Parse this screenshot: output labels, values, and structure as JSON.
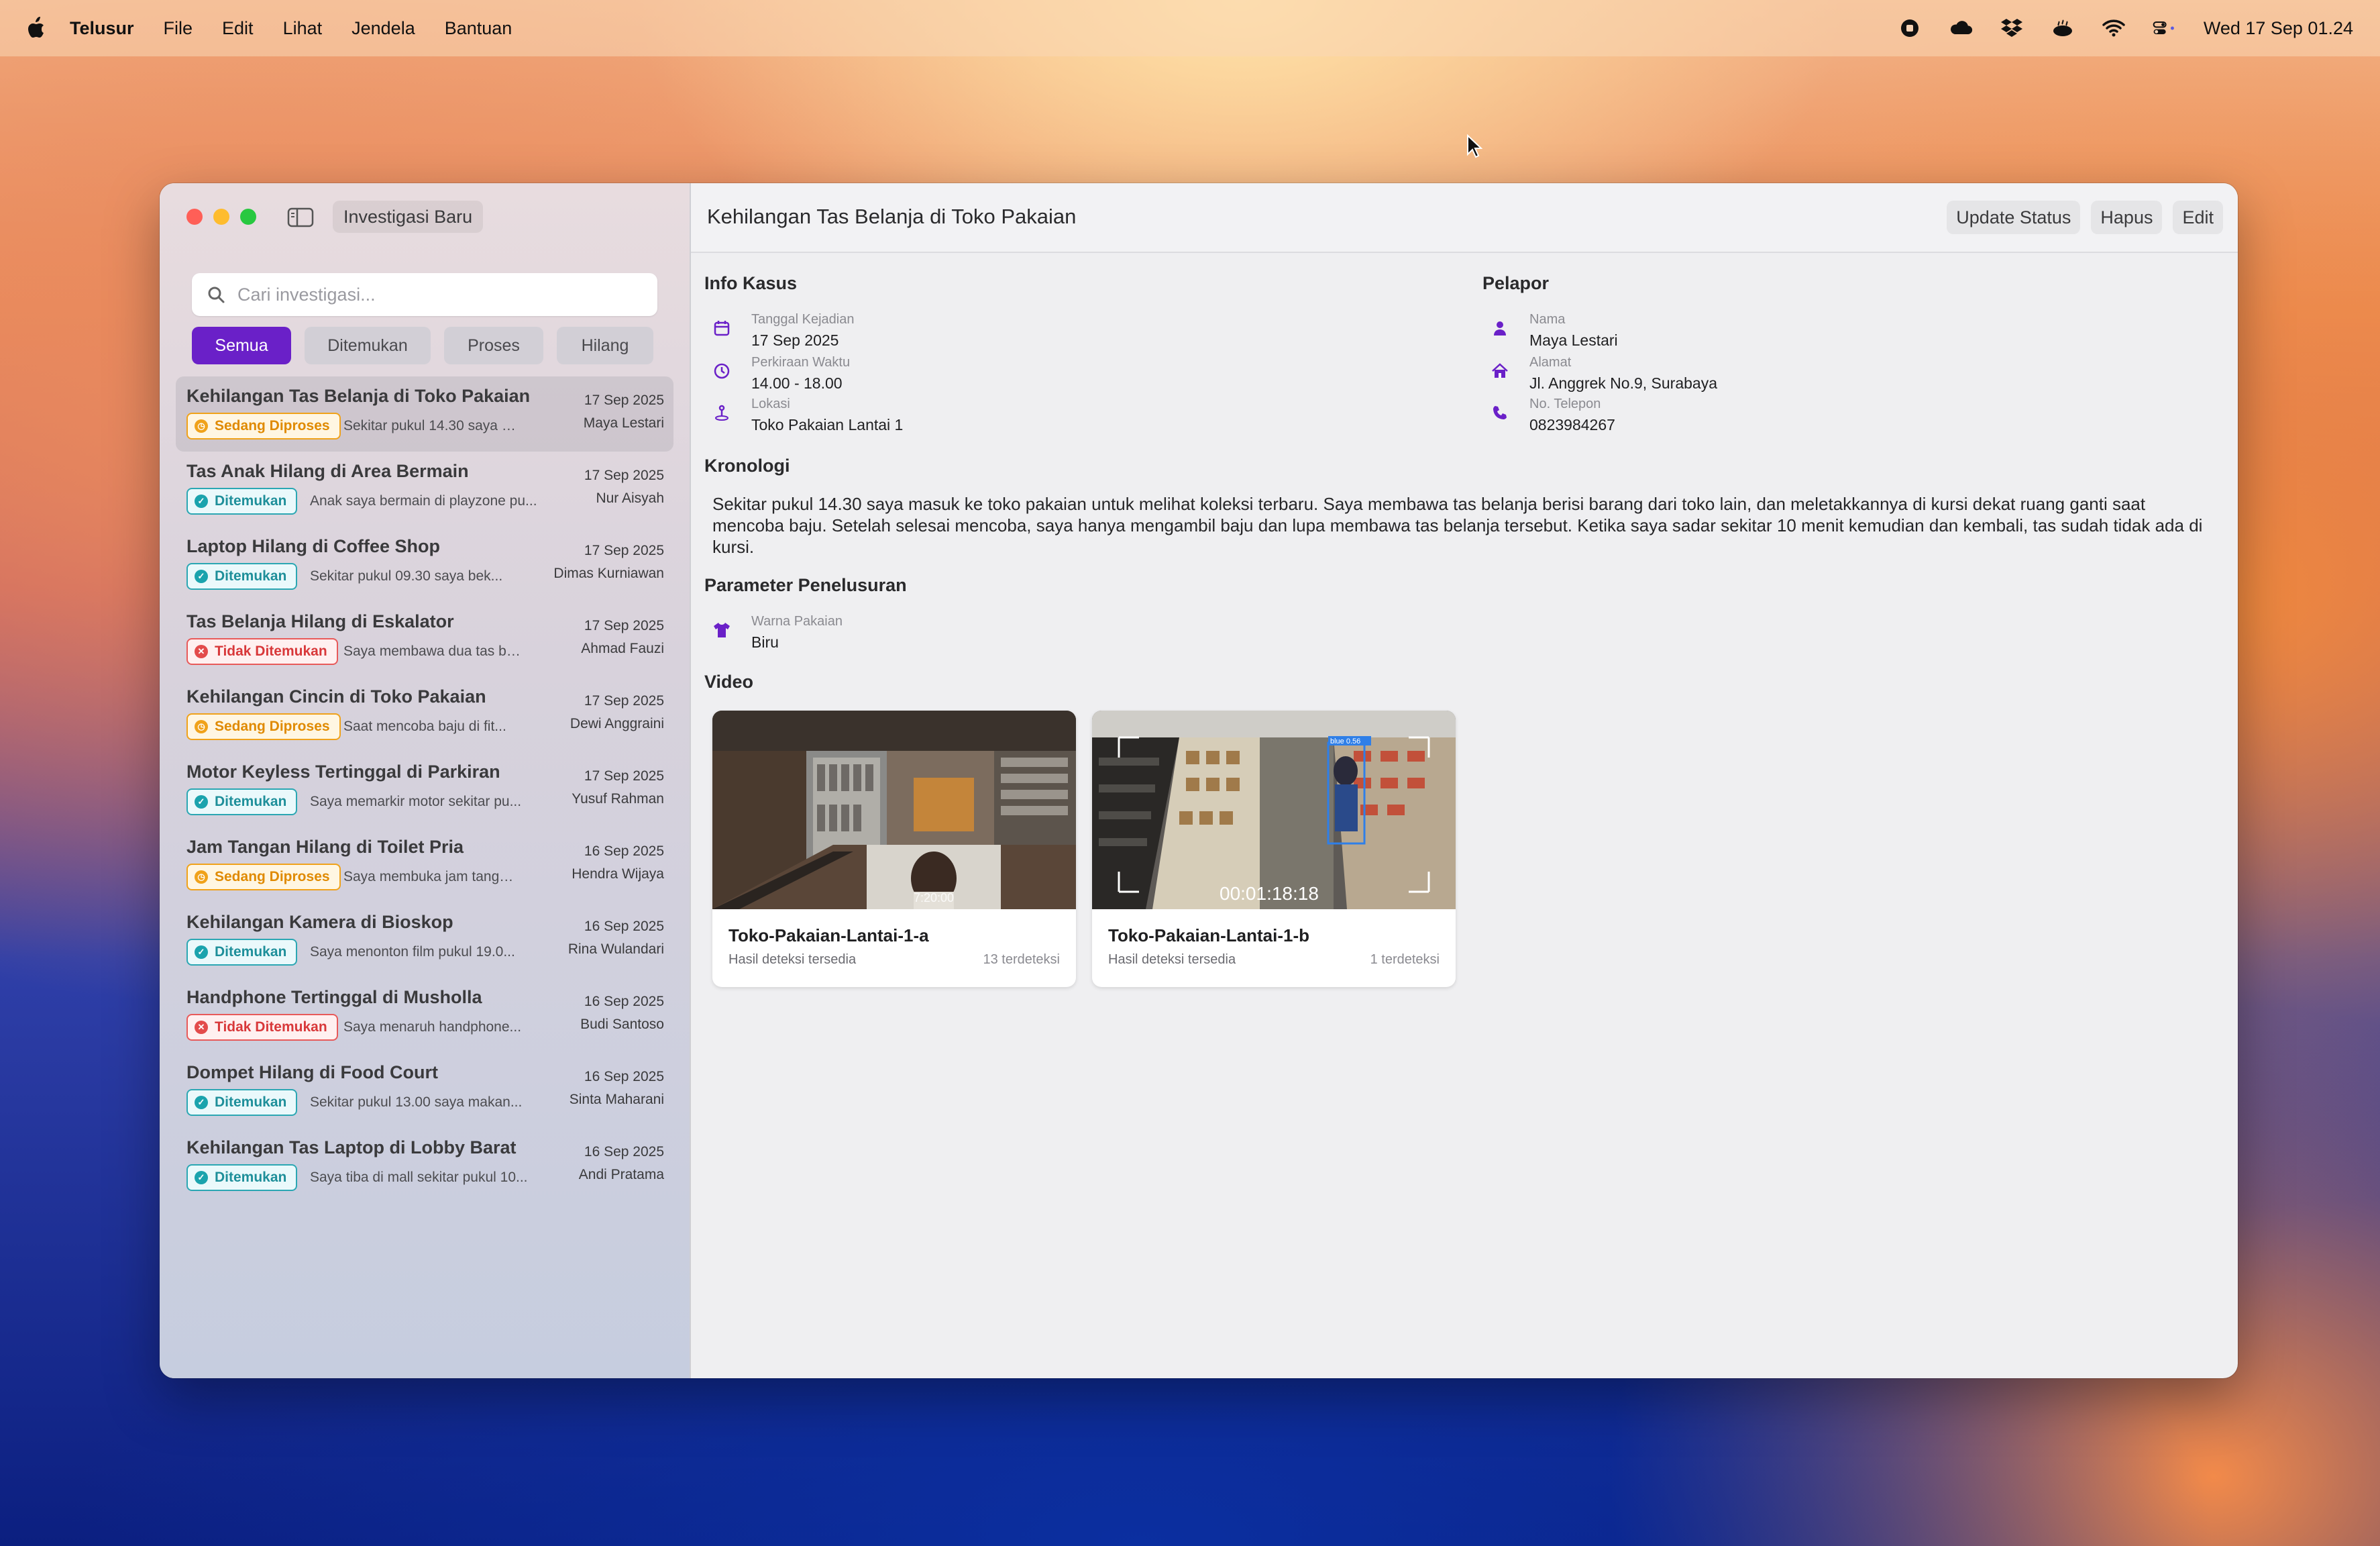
{
  "menubar": {
    "app": "Telusur",
    "items": [
      "File",
      "Edit",
      "Lihat",
      "Jendela",
      "Bantuan"
    ],
    "clock": "Wed 17 Sep  01.24"
  },
  "sidebar": {
    "new_button": "Investigasi Baru",
    "search_placeholder": "Cari investigasi...",
    "filters": [
      "Semua",
      "Ditemukan",
      "Proses",
      "Hilang"
    ],
    "active_filter": "Semua",
    "cases": [
      {
        "title": "Kehilangan Tas Belanja di Toko Pakaian",
        "date": "17 Sep 2025",
        "status": "Sedang Diproses",
        "preview": "Sekitar pukul 14.30 saya m...",
        "person": "Maya Lestari"
      },
      {
        "title": "Tas Anak Hilang di Area Bermain",
        "date": "17 Sep 2025",
        "status": "Ditemukan",
        "preview": "Anak saya bermain di playzone pu...",
        "person": "Nur Aisyah"
      },
      {
        "title": "Laptop Hilang di Coffee Shop",
        "date": "17 Sep 2025",
        "status": "Ditemukan",
        "preview": "Sekitar pukul 09.30 saya bek...",
        "person": "Dimas Kurniawan"
      },
      {
        "title": "Tas Belanja Hilang di Eskalator",
        "date": "17 Sep 2025",
        "status": "Tidak Ditemukan",
        "preview": "Saya membawa dua tas bel...",
        "person": "Ahmad Fauzi"
      },
      {
        "title": "Kehilangan Cincin di Toko Pakaian",
        "date": "17 Sep 2025",
        "status": "Sedang Diproses",
        "preview": "Saat mencoba baju di fit...",
        "person": "Dewi Anggraini"
      },
      {
        "title": "Motor Keyless Tertinggal di Parkiran",
        "date": "17 Sep 2025",
        "status": "Ditemukan",
        "preview": "Saya memarkir motor sekitar pu...",
        "person": "Yusuf Rahman"
      },
      {
        "title": "Jam Tangan Hilang di Toilet Pria",
        "date": "16 Sep 2025",
        "status": "Sedang Diproses",
        "preview": "Saya membuka jam tanga...",
        "person": "Hendra Wijaya"
      },
      {
        "title": "Kehilangan Kamera di Bioskop",
        "date": "16 Sep 2025",
        "status": "Ditemukan",
        "preview": "Saya menonton film pukul 19.0...",
        "person": "Rina Wulandari"
      },
      {
        "title": "Handphone Tertinggal di Musholla",
        "date": "16 Sep 2025",
        "status": "Tidak Ditemukan",
        "preview": "Saya menaruh handphone...",
        "person": "Budi Santoso"
      },
      {
        "title": "Dompet Hilang di Food Court",
        "date": "16 Sep 2025",
        "status": "Ditemukan",
        "preview": "Sekitar pukul 13.00 saya makan...",
        "person": "Sinta Maharani"
      },
      {
        "title": "Kehilangan Tas Laptop di Lobby Barat",
        "date": "16 Sep 2025",
        "status": "Ditemukan",
        "preview": "Saya tiba di mall sekitar pukul 10...",
        "person": "Andi Pratama"
      }
    ]
  },
  "detail": {
    "title": "Kehilangan Tas Belanja di Toko Pakaian",
    "actions": {
      "update": "Update Status",
      "delete": "Hapus",
      "edit": "Edit"
    },
    "info_kasus": {
      "heading": "Info Kasus",
      "date_label": "Tanggal Kejadian",
      "date": "17 Sep 2025",
      "time_label": "Perkiraan Waktu",
      "time": "14.00 - 18.00",
      "location_label": "Lokasi",
      "location": "Toko Pakaian Lantai 1"
    },
    "pelapor": {
      "heading": "Pelapor",
      "name_label": "Nama",
      "name": "Maya Lestari",
      "address_label": "Alamat",
      "address": "Jl. Anggrek No.9, Surabaya",
      "phone_label": "No. Telepon",
      "phone": "0823984267"
    },
    "kronologi": {
      "heading": "Kronologi",
      "text": "Sekitar pukul 14.30 saya masuk ke toko pakaian untuk melihat koleksi terbaru. Saya membawa tas belanja berisi barang dari toko lain, dan meletakkannya di kursi dekat ruang ganti saat mencoba baju. Setelah selesai mencoba, saya hanya mengambil baju dan lupa membawa tas belanja tersebut. Ketika saya sadar sekitar 10 menit kemudian dan kembali, tas sudah tidak ada di kursi."
    },
    "parameter": {
      "heading": "Parameter Penelusuran",
      "color_label": "Warna Pakaian",
      "color": "Biru"
    },
    "video": {
      "heading": "Video",
      "items": [
        {
          "name": "Toko-Pakaian-Lantai-1-a",
          "sub": "Hasil deteksi tersedia",
          "count": "13 terdeteksi",
          "overlay": "7:20:00"
        },
        {
          "name": "Toko-Pakaian-Lantai-1-b",
          "sub": "Hasil deteksi tersedia",
          "count": "1 terdeteksi",
          "overlay": "00:01:18:18",
          "box_label": "blue 0.56"
        }
      ]
    }
  },
  "colors": {
    "accent": "#6a20c8",
    "processing": "#f0a21a",
    "found": "#1aa3ad",
    "lost": "#e34b4b"
  }
}
